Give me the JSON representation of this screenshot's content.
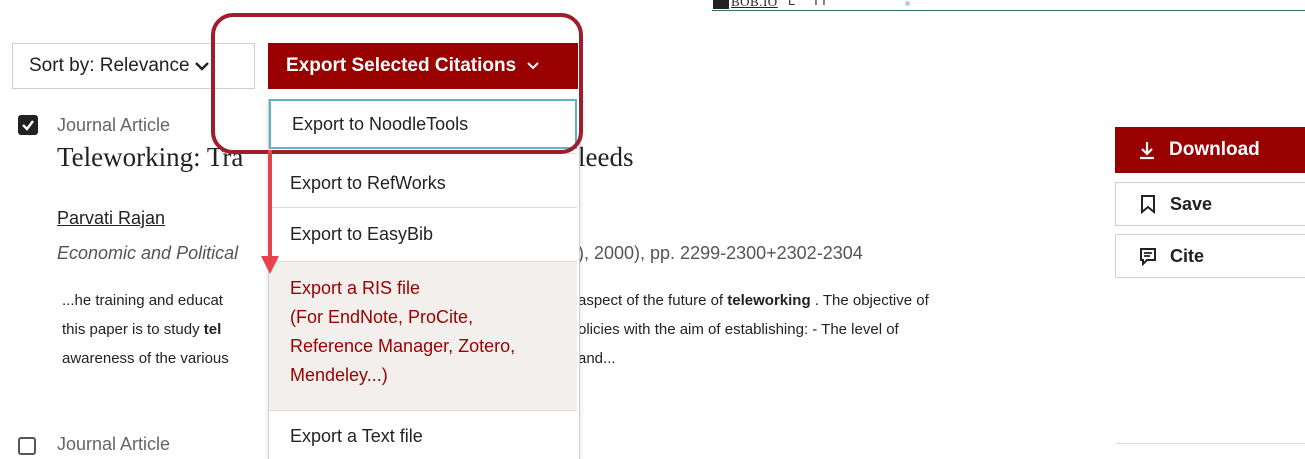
{
  "topstrip": {
    "logo_text": "BOB.IO",
    "frag1": "L",
    "frag2": "TT"
  },
  "toolbar": {
    "sort_label": "Sort by: Relevance",
    "export_label": "Export Selected Citations"
  },
  "dropdown": {
    "items": [
      "Export to NoodleTools",
      "Export to RefWorks",
      "Export to EasyBib",
      "Export a RIS file",
      "Export a Text file"
    ],
    "ris_lines": [
      "Export a RIS file",
      "(For EndNote, ProCite,",
      "Reference Manager, Zotero,",
      "Mendeley...)"
    ]
  },
  "result": {
    "type": "Journal Article",
    "title_left": "Teleworking: Tra",
    "title_right": "leeds",
    "author": "Parvati Rajan",
    "journal": "Economic and Political",
    "pages": "), 2000), pp. 2299-2300+2302-2304",
    "snippet": {
      "l1a": "...he training and educat",
      "l1b_pre": "aspect of the future of ",
      "l1b_bold": "teleworking",
      "l1b_post": " . The objective of",
      "l2a_pre": "this paper is to study ",
      "l2a_bold": "tel",
      "l2b": "olicies with the aim of establishing: - The level of",
      "l3a": "awareness of the various",
      "l3b": "and..."
    }
  },
  "result2": {
    "type": "Journal Article"
  },
  "actions": {
    "download": "Download",
    "save": "Save",
    "cite": "Cite"
  },
  "colors": {
    "brand": "#990000",
    "highlight": "#a01d2e",
    "arrow": "#e8424d"
  }
}
